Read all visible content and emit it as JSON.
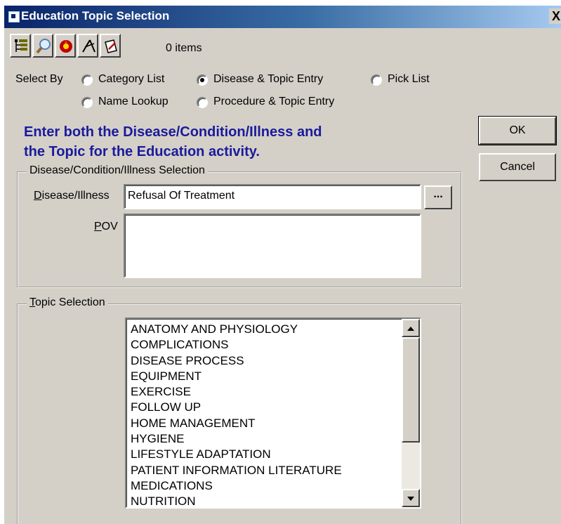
{
  "window": {
    "title": "Education Topic Selection",
    "close_label": "X"
  },
  "toolbar": {
    "buttons": [
      {
        "icon": "tree-list-icon"
      },
      {
        "icon": "magnifier-icon"
      },
      {
        "icon": "red-flower-icon"
      },
      {
        "icon": "compass-icon"
      },
      {
        "icon": "note-pencil-icon"
      }
    ],
    "items_count": "0 items"
  },
  "select_by": {
    "label": "Select By",
    "options": [
      {
        "label": "Category List",
        "selected": false
      },
      {
        "label": "Disease & Topic Entry",
        "selected": true
      },
      {
        "label": "Pick List",
        "selected": false
      },
      {
        "label": "Name Lookup",
        "selected": false
      },
      {
        "label": "Procedure & Topic Entry",
        "selected": false
      }
    ]
  },
  "instruction": {
    "line1": "Enter both the Disease/Condition/Illness and",
    "line2": "the Topic for the Education activity."
  },
  "buttons": {
    "ok": "OK",
    "cancel": "Cancel"
  },
  "disease_group": {
    "title": "Disease/Condition/Illness Selection",
    "disease_label_underlined": "D",
    "disease_label_rest": "isease/Illness",
    "disease_value": "Refusal Of Treatment",
    "browse_label": "...",
    "pov_label_underlined": "P",
    "pov_label_rest": "OV",
    "pov_value": ""
  },
  "topic_group": {
    "title_underlined": "T",
    "title_rest": "opic Selection",
    "topics": [
      "ANATOMY AND PHYSIOLOGY",
      "COMPLICATIONS",
      "DISEASE PROCESS",
      "EQUIPMENT",
      "EXERCISE",
      "FOLLOW UP",
      "HOME MANAGEMENT",
      "HYGIENE",
      "LIFESTYLE ADAPTATION",
      "PATIENT INFORMATION LITERATURE",
      "MEDICATIONS",
      "NUTRITION"
    ]
  },
  "colors": {
    "titlebar_start": "#0a246a",
    "titlebar_end": "#a6caf0",
    "dialog_bg": "#d4d0c8",
    "instruction_text": "#1a1a9c"
  }
}
